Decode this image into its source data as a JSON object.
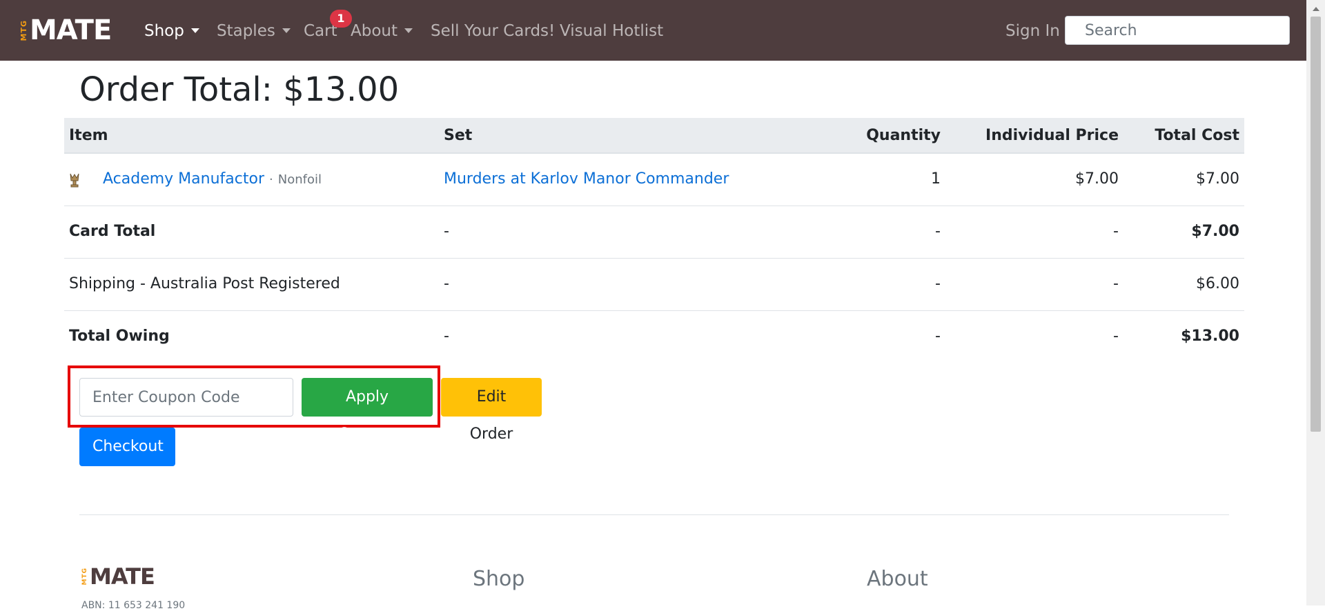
{
  "nav": {
    "logo_small": "MTG",
    "logo_word": "MATE",
    "shop": "Shop",
    "staples": "Staples",
    "cart": "Cart",
    "cart_count": "1",
    "about": "About",
    "sell": "Sell Your Cards!",
    "visual_hotlist": "Visual Hotlist",
    "sign_in": "Sign In",
    "search_placeholder": "Search"
  },
  "order": {
    "title": "Order Total: $13.00",
    "headers": {
      "item": "Item",
      "set": "Set",
      "quantity": "Quantity",
      "individual_price": "Individual Price",
      "total_cost": "Total Cost"
    },
    "items": [
      {
        "name": "Academy Manufactor",
        "separator": "·",
        "finish": "Nonfoil",
        "set": "Murders at Karlov Manor Commander",
        "quantity": "1",
        "price": "$7.00",
        "total": "$7.00"
      }
    ],
    "summary": [
      {
        "label": "Card Total",
        "set": "-",
        "quantity": "-",
        "price": "-",
        "total": "$7.00"
      },
      {
        "label": "Shipping - Australia Post Registered",
        "set": "-",
        "quantity": "-",
        "price": "-",
        "total": "$6.00"
      },
      {
        "label": "Total Owing",
        "set": "-",
        "quantity": "-",
        "price": "-",
        "total": "$13.00"
      }
    ]
  },
  "coupon": {
    "placeholder": "Enter Coupon Code",
    "apply_label": "Apply Coupon"
  },
  "actions": {
    "edit_label": "Edit Order",
    "checkout_label": "Checkout"
  },
  "footer": {
    "logo_small": "MTG",
    "logo_word": "MATE",
    "abn": "ABN: 11 653 241 190",
    "shop_heading": "Shop",
    "about_heading": "About"
  },
  "colors": {
    "navbar": "#4e3d3e",
    "link": "#0c6fd6",
    "success": "#28a745",
    "warning": "#ffc107",
    "primary": "#007bff",
    "highlight": "#e60000",
    "badge": "#dc3545"
  }
}
